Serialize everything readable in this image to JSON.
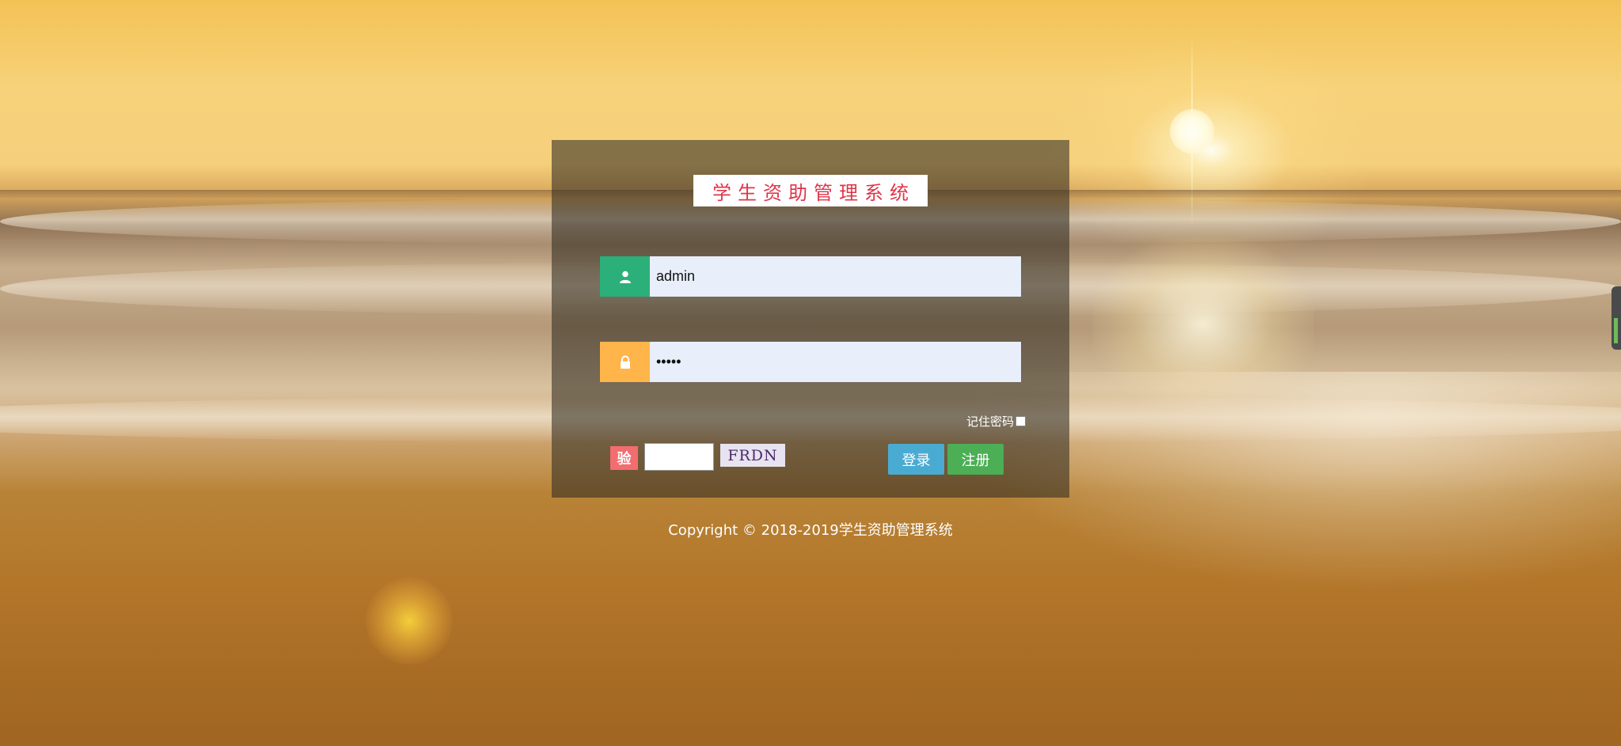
{
  "system_title": "学生资助管理系统",
  "login_form": {
    "username": {
      "icon": "user-icon",
      "value": "admin"
    },
    "password": {
      "icon": "lock-icon",
      "value": "•••••"
    },
    "remember_label": "记住密码",
    "remember_checked": false,
    "captcha": {
      "badge_label": "验",
      "input_value": "",
      "image_text": "FRDN"
    },
    "login_button": "登录",
    "register_button": "注册"
  },
  "footer": {
    "copyright": "Copyright © 2018-2019学生资助管理系统"
  },
  "colors": {
    "user_icon_bg": "#2bb07a",
    "lock_icon_bg": "#ffb54a",
    "captcha_badge_bg": "#f26d70",
    "login_button_bg": "#4aabd2",
    "register_button_bg": "#4cae55",
    "title_text": "#e0354a"
  }
}
